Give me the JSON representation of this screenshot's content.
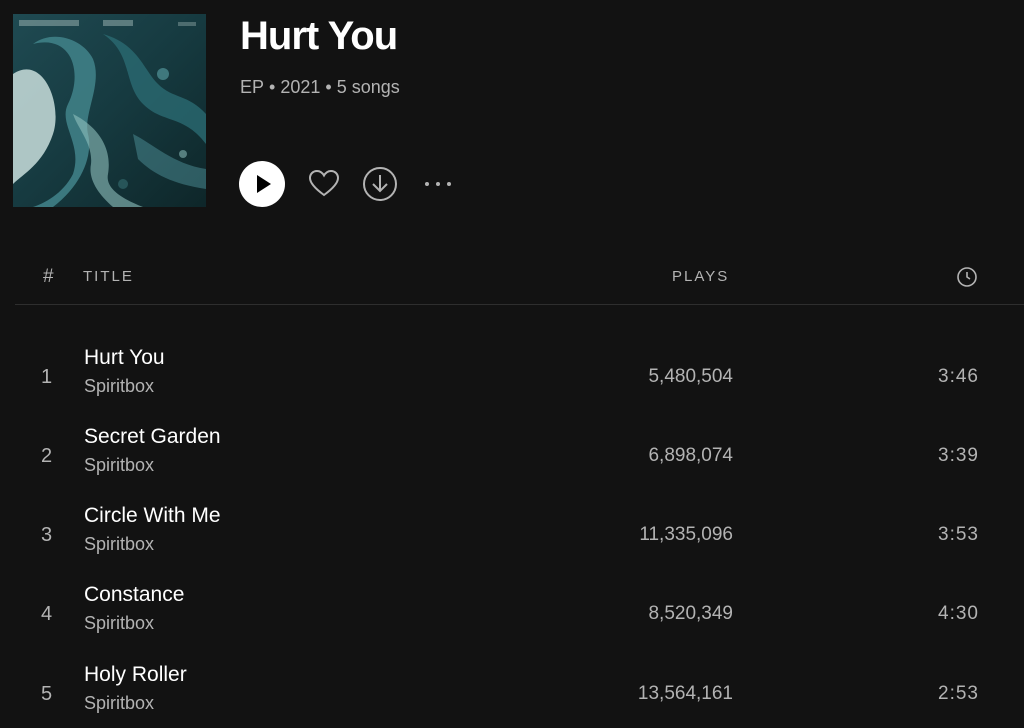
{
  "album": {
    "title": "Hurt You",
    "type": "EP",
    "year": "2021",
    "song_count": "5 songs",
    "separator": "•"
  },
  "controls": {
    "play_icon": "play-icon",
    "like_icon": "heart-icon",
    "download_icon": "download-icon",
    "more_icon": "more-horizontal-icon"
  },
  "table": {
    "header": {
      "number": "#",
      "title": "TITLE",
      "plays": "PLAYS",
      "duration_icon": "clock-icon"
    },
    "tracks": [
      {
        "number": "1",
        "title": "Hurt You",
        "artist": "Spiritbox",
        "plays": "5,480,504",
        "duration": "3:46"
      },
      {
        "number": "2",
        "title": "Secret Garden",
        "artist": "Spiritbox",
        "plays": "6,898,074",
        "duration": "3:39"
      },
      {
        "number": "3",
        "title": "Circle With Me",
        "artist": "Spiritbox",
        "plays": "11,335,096",
        "duration": "3:53"
      },
      {
        "number": "4",
        "title": "Constance",
        "artist": "Spiritbox",
        "plays": "8,520,349",
        "duration": "4:30"
      },
      {
        "number": "5",
        "title": "Holy Roller",
        "artist": "Spiritbox",
        "plays": "13,564,161",
        "duration": "2:53"
      }
    ]
  },
  "colors": {
    "background": "#121212",
    "primary_text": "#ffffff",
    "secondary_text": "#b3b3b3",
    "divider": "#2e2e2e",
    "cover_teal": "#2d5f63"
  }
}
